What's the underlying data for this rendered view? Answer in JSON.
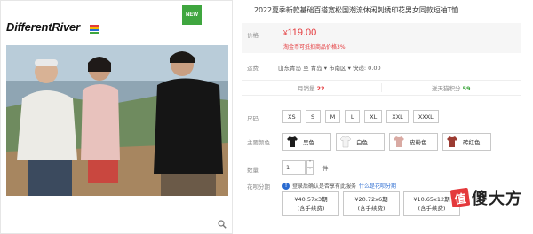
{
  "gallery": {
    "brand": "DifferentRiver",
    "brand_colors": [
      "#e4393c",
      "#f5b800",
      "#2a6bd1",
      "#3fa63f"
    ],
    "badge": "NEW",
    "badge_color": "#3fa63f",
    "zoom_icon": "magnifier-icon"
  },
  "product": {
    "title": "2022夏季新款基础百搭宽松国潮流休闲刺绣印花男女同款短袖T恤",
    "price_label": "价格",
    "currency": "¥",
    "price": "119.00",
    "promo": "淘金币可抵扣商品价格3%",
    "shipping_label": "运费",
    "shipping_text": "山东青岛  至  青岛 ▾ 市南区 ▾  快递: 0.00",
    "stats": {
      "monthly_sales_label": "月销量",
      "monthly_sales": "22",
      "points_label": "送天猫积分",
      "points": "59"
    }
  },
  "options": {
    "size_label": "尺码",
    "sizes": [
      "XS",
      "S",
      "M",
      "L",
      "XL",
      "XXL",
      "XXXL"
    ],
    "color_label": "主要颜色",
    "colors": [
      {
        "name": "黑色",
        "swatch": "#1c1c1c"
      },
      {
        "name": "白色",
        "swatch": "#f3f3f3"
      },
      {
        "name": "皮粉色",
        "swatch": "#d9aaa3"
      },
      {
        "name": "砖红色",
        "swatch": "#9b3b32"
      }
    ],
    "qty_label": "数量",
    "qty_value": "1",
    "qty_unit": "件",
    "installment_label": "花呗分期",
    "installment_tip": "登录后确认是否享有此服务",
    "installment_link": "什么是花呗分期",
    "plans": [
      {
        "amount": "¥40.57x3期",
        "note": "(含手续费)"
      },
      {
        "amount": "¥20.72x6期",
        "note": "(含手续费)"
      },
      {
        "amount": "¥10.65x12期",
        "note": "(含手续费)"
      }
    ]
  },
  "watermark": {
    "logo": "值",
    "text": "傻大方"
  },
  "colors": {
    "accent_red": "#e4393c",
    "link_blue": "#2a6bd1",
    "green": "#3fa63f"
  }
}
